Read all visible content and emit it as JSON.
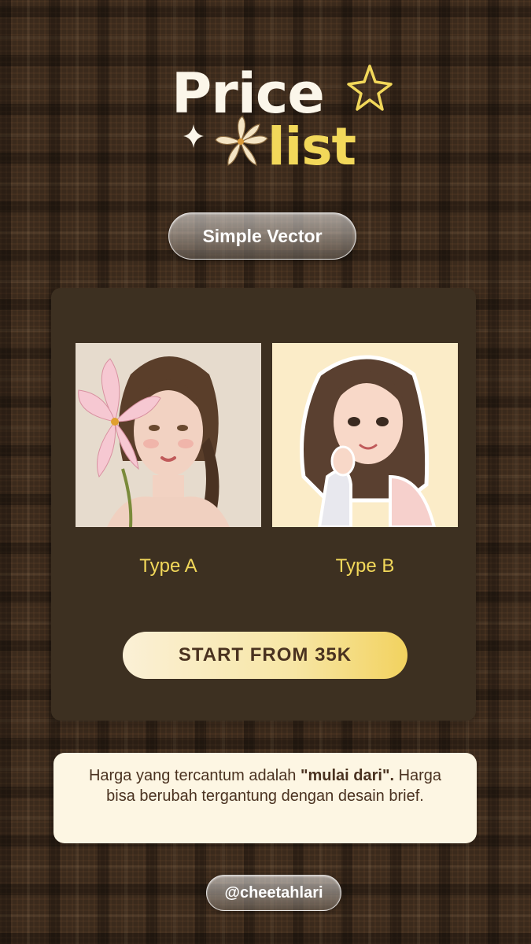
{
  "header": {
    "title_line1": "Price",
    "title_line2": "list",
    "category": "Simple Vector"
  },
  "card": {
    "samples": [
      {
        "label": "Type A"
      },
      {
        "label": "Type B"
      }
    ],
    "cta": "START FROM 35K"
  },
  "note": {
    "prefix": "Harga yang tercantum adalah ",
    "emphasis": "\"mulai dari\".",
    "rest": "Harga bisa berubah tergantung dengan desain brief."
  },
  "footer": {
    "handle": "@cheetahlari"
  },
  "colors": {
    "background": "#3b2a1c",
    "card": "#3d3021",
    "accent_yellow": "#f2d85a",
    "cream": "#fdf6e3",
    "text_brown": "#4a3220"
  },
  "icons": [
    "sparkle-star-icon",
    "small-sparkle-icon",
    "lily-flower-icon"
  ]
}
